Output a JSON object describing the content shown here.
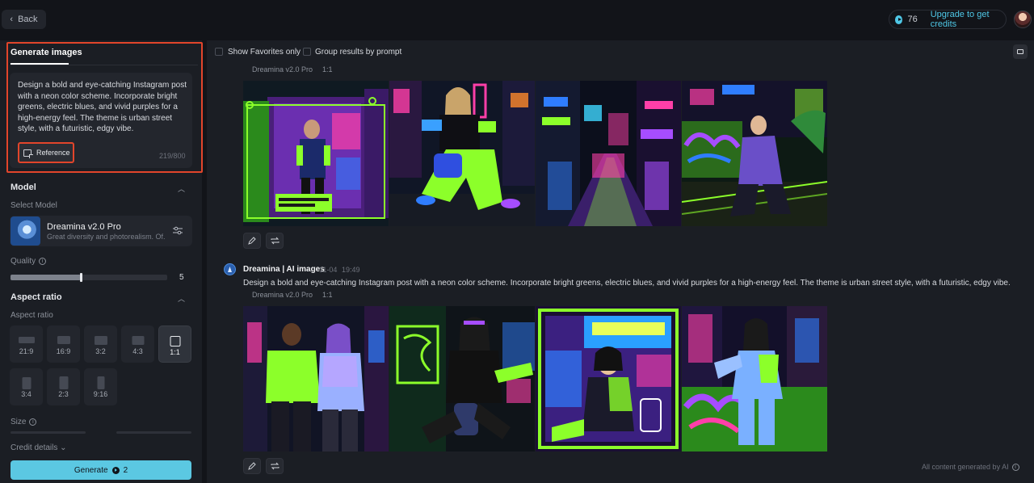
{
  "header": {
    "back_label": "Back",
    "credits_count": "76",
    "upgrade_label": "Upgrade to get credits"
  },
  "left_panel": {
    "tab_label": "Generate images",
    "prompt_text": "Design a bold and eye-catching Instagram post with a neon color scheme. Incorporate bright greens, electric blues, and vivid purples for a high-energy feel. The theme is urban street style, with a futuristic, edgy vibe.",
    "reference_label": "Reference",
    "char_count": "219/800",
    "model_section": "Model",
    "select_model_label": "Select Model",
    "model_name": "Dreamina v2.0 Pro",
    "model_desc": "Great diversity and photorealism. Of...",
    "quality_label": "Quality",
    "quality_value": "5",
    "quality_fraction": 0.45,
    "aspect_section": "Aspect ratio",
    "aspect_sub_label": "Aspect ratio",
    "ratios": [
      {
        "label": "21:9",
        "selected": false
      },
      {
        "label": "16:9",
        "selected": false
      },
      {
        "label": "3:2",
        "selected": false
      },
      {
        "label": "4:3",
        "selected": false
      },
      {
        "label": "1:1",
        "selected": true
      },
      {
        "label": "3:4",
        "selected": false
      },
      {
        "label": "2:3",
        "selected": false
      },
      {
        "label": "9:16",
        "selected": false
      }
    ],
    "size_label": "Size",
    "credit_details_label": "Credit details",
    "generate_label": "Generate",
    "generate_cost": "2"
  },
  "main": {
    "show_favorites_label": "Show Favorites only",
    "group_results_label": "Group results by prompt",
    "groups": [
      {
        "model_tag": "Dreamina v2.0 Pro",
        "ratio_tag": "1:1"
      },
      {
        "bot_name": "Dreamina | AI images",
        "date": "11-04",
        "time": "19:49",
        "prompt": "Design a bold and eye-catching Instagram post with a neon color scheme. Incorporate bright greens, electric blues, and vivid purples for a high-energy feel. The theme is urban street style, with a futuristic, edgy vibe.",
        "model_tag": "Dreamina v2.0 Pro",
        "ratio_tag": "1:1"
      }
    ],
    "ai_note": "All content generated by AI"
  },
  "colors": {
    "accent": "#5bc8e2",
    "highlight": "#e2452b",
    "neon_green": "#8cff2a",
    "neon_purple": "#a64dff",
    "neon_blue": "#2f7dff",
    "neon_pink": "#ff3fa8"
  }
}
